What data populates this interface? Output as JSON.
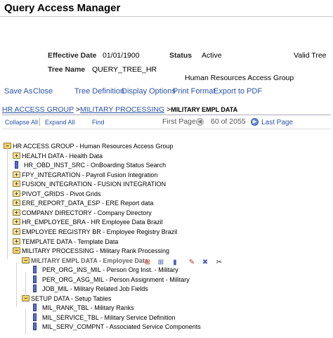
{
  "page": {
    "title": "Query Access Manager"
  },
  "header": {
    "effective_date_label": "Effective Date",
    "effective_date": "01/01/1900",
    "status_label": "Status",
    "status": "Active",
    "valid_tree": "Valid Tree",
    "tree_name_label": "Tree Name",
    "tree_name": "QUERY_TREE_HR",
    "description": "Human Resources Access Group"
  },
  "toolbar": {
    "save_as": "Save As",
    "close": "Close",
    "tree_definition": "Tree Definition",
    "display_options": "Display Options",
    "print_format": "Print Format",
    "export_pdf": "Export to PDF"
  },
  "breadcrumb": {
    "item1": "HR ACCESS GROUP",
    "sep1": " >",
    "item2": "MILITARY PROCESSING",
    "sep2": " >",
    "current": "MILITARY EMPL DATA"
  },
  "nav": {
    "collapse_all": "Collapse All",
    "expand_all": "Expand All",
    "find": "Find",
    "first_page": "First Page",
    "count": "60 of 2055",
    "last_page": "Last Page"
  },
  "tree": [
    {
      "text": "HR ACCESS GROUP - Human Resources Access Group",
      "kind": "folder-open",
      "level": 0
    },
    {
      "text": "HEALTH DATA - Health Data",
      "kind": "folder",
      "level": 1
    },
    {
      "text": "HR_OBD_INST_SRC - OnBoarding Status Search",
      "kind": "leaf",
      "level": 1
    },
    {
      "text": "FPY_INTEGRATION - Payroll Fusion Integration",
      "kind": "folder",
      "level": 1
    },
    {
      "text": "FUSION_INTEGRATION - FUSION INTEGRATION",
      "kind": "folder",
      "level": 1
    },
    {
      "text": "PIVOT_GRIDS - Pivot Grids",
      "kind": "folder",
      "level": 1
    },
    {
      "text": "ERE_REPORT_DATA_ESP - ERE Report data",
      "kind": "folder",
      "level": 1
    },
    {
      "text": "COMPANY DIRECTORY - Company Directory",
      "kind": "folder",
      "level": 1
    },
    {
      "text": "HR_EMPLOYEE_BRA - HR Employee Data Brazil",
      "kind": "folder",
      "level": 1
    },
    {
      "text": "EMPLOYEE REGISTRY BR - Employee Registry Brazil",
      "kind": "folder",
      "level": 1
    },
    {
      "text": "TEMPLATE DATA - Template Data",
      "kind": "folder",
      "level": 1
    },
    {
      "text": "MILITARY PROCESSING - Military Rank Processing",
      "kind": "folder-open",
      "level": 1
    },
    {
      "text": "MILITARY EMPL DATA - Employee Data",
      "kind": "folder-open",
      "level": 2,
      "highlight": true
    },
    {
      "text": "PER_ORG_INS_MIL - Person Org Inst. - Military",
      "kind": "leaf",
      "level": 3
    },
    {
      "text": "PER_ORG_ASG_MIL - Person Assignment - Military",
      "kind": "leaf",
      "level": 3
    },
    {
      "text": "JOB_MIL - Military Related Job Fields",
      "kind": "leaf",
      "level": 3
    },
    {
      "text": "SETUP DATA - Setup Tables",
      "kind": "folder-open",
      "level": 2
    },
    {
      "text": "MIL_RANK_TBL - Military Ranks",
      "kind": "leaf",
      "level": 3
    },
    {
      "text": "MIL_SERVICE_TBL - Military Service Definition",
      "kind": "leaf",
      "level": 3
    },
    {
      "text": "MIL_SERV_COMPNT - Associated Service Components",
      "kind": "leaf",
      "level": 3
    }
  ],
  "node_actions": [
    {
      "name": "insert-child-node-icon",
      "glyph": "⊞",
      "color": "#c0392b"
    },
    {
      "name": "insert-sibling-node-icon",
      "glyph": "⊞",
      "color": "#2a52a8"
    },
    {
      "name": "insert-child-leaf-icon",
      "glyph": "▮",
      "color": "#4a5fc1"
    },
    {
      "name": "edit-data-icon",
      "glyph": "✎",
      "color": "#b03030"
    },
    {
      "name": "delete-node-icon",
      "glyph": "✖",
      "color": "#4a5fc1"
    },
    {
      "name": "cut-icon",
      "glyph": "✂",
      "color": "#333"
    }
  ]
}
